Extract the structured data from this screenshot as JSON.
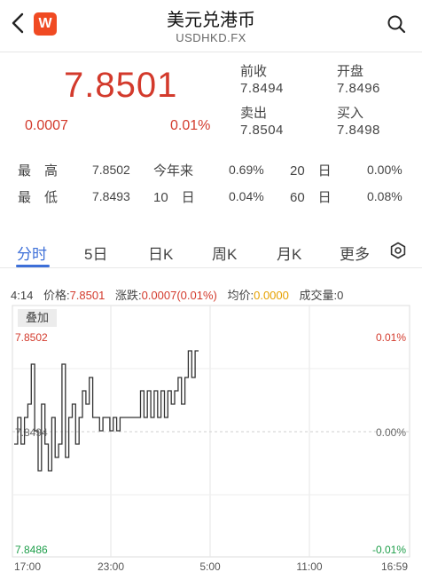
{
  "header": {
    "title": "美元兑港币",
    "subtitle": "USDHKD.FX",
    "logo_text": "W",
    "accent": "#f04a22"
  },
  "quote": {
    "price": "7.8501",
    "change": "0.0007",
    "change_pct": "0.01%",
    "prev_close_label": "前收",
    "prev_close": "7.8494",
    "open_label": "开盘",
    "open": "7.8496",
    "sell_label": "卖出",
    "sell": "7.8504",
    "buy_label": "买入",
    "buy": "7.8498",
    "up_color": "#d33a2c"
  },
  "stats": {
    "high_label": "最　高",
    "high": "7.8502",
    "ytd_label": "今年来",
    "ytd": "0.69%",
    "d20_label": "20　日",
    "d20": "0.00%",
    "low_label": "最　低",
    "low": "7.8493",
    "d10_label": "10　日",
    "d10": "0.04%",
    "d60_label": "60　日",
    "d60": "0.08%"
  },
  "tabs": [
    {
      "label": "分时",
      "active": true
    },
    {
      "label": "5日"
    },
    {
      "label": "日K"
    },
    {
      "label": "周K"
    },
    {
      "label": "月K"
    },
    {
      "label": "更多"
    }
  ],
  "info_line": {
    "time": "4:14",
    "price_label": "价格:",
    "price": "7.8501",
    "change_label": "涨跌:",
    "change": "0.0007(0.01%)",
    "avg_label": "均价:",
    "avg": "0.0000",
    "volume_label": "成交量:",
    "volume": "0"
  },
  "chart": {
    "overlay_label": "叠加",
    "y_top_label": "7.8502",
    "y_mid_label": "7.8494",
    "y_bottom_label": "7.8486",
    "pct_top_label": "0.01%",
    "pct_mid_label": "0.00%",
    "pct_bottom_label": "-0.01%",
    "x_labels": [
      "17:00",
      "23:00",
      "5:00",
      "11:00",
      "16:59"
    ]
  },
  "chart_data": {
    "type": "line",
    "ylim": [
      7.8486,
      7.8502
    ],
    "reference": 7.8494,
    "x_ticks": [
      "17:00",
      "23:00",
      "5:00",
      "11:00",
      "16:59"
    ],
    "values": [
      7.8494,
      7.8496,
      7.8494,
      7.8496,
      7.8497,
      7.85,
      7.8495,
      7.8492,
      7.8497,
      7.8494,
      7.8492,
      7.8496,
      7.8493,
      7.8494,
      7.85,
      7.8493,
      7.8496,
      7.8497,
      7.8494,
      7.8496,
      7.8498,
      7.8497,
      7.8499,
      7.8496,
      7.8496,
      7.8495,
      7.8496,
      7.8496,
      7.8495,
      7.8496,
      7.8495,
      7.8496,
      7.8496,
      7.8496,
      7.8496,
      7.8496,
      7.8496,
      7.8498,
      7.8496,
      7.8498,
      7.8496,
      7.8498,
      7.8496,
      7.8498,
      7.8496,
      7.8498,
      7.8497,
      7.8498,
      7.8499,
      7.8497,
      7.8499,
      7.8501,
      7.8499,
      7.8501,
      7.8501
    ]
  }
}
